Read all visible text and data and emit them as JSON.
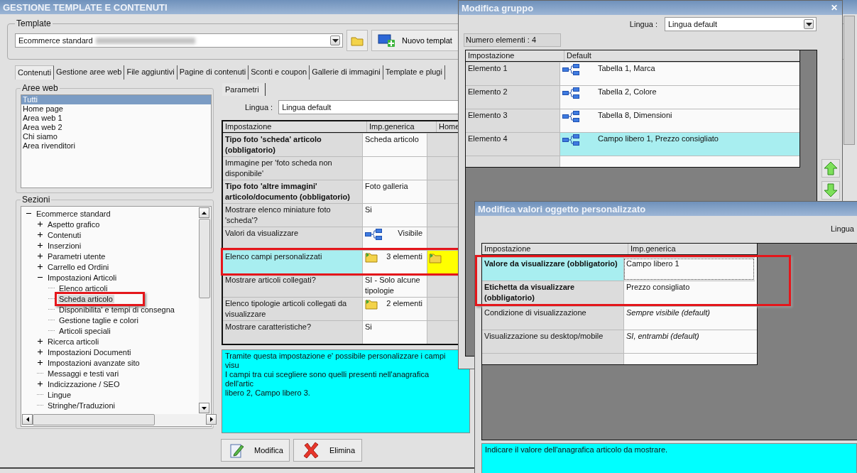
{
  "main_window": {
    "title": "GESTIONE TEMPLATE E CONTENUTI",
    "template_group": {
      "label": "Template",
      "value": "Ecommerce standard",
      "new_button": "Nuovo templat"
    },
    "tabs": [
      {
        "label": "Contenuti",
        "selected": true
      },
      {
        "label": "Gestione aree web",
        "selected": false
      },
      {
        "label": "File aggiuntivi",
        "selected": false
      },
      {
        "label": "Pagine di contenuti",
        "selected": false
      },
      {
        "label": "Sconti e coupon",
        "selected": false
      },
      {
        "label": "Gallerie di immagini",
        "selected": false
      },
      {
        "label": "Template e plugi",
        "selected": false
      }
    ],
    "aree_web": {
      "label": "Aree web",
      "items": [
        {
          "label": "Tutti",
          "selected": true
        },
        {
          "label": "Home page",
          "selected": false
        },
        {
          "label": "Area web 1",
          "selected": false
        },
        {
          "label": "Area web 2",
          "selected": false
        },
        {
          "label": "Chi siamo",
          "selected": false
        },
        {
          "label": "Area rivenditori",
          "selected": false
        }
      ]
    },
    "sezioni": {
      "label": "Sezioni",
      "tree": [
        {
          "label": "Ecommerce standard",
          "expanded": true,
          "selected": false,
          "marked": false,
          "children": [
            {
              "label": "Aspetto grafico",
              "expanded": false,
              "selected": false,
              "marked": false
            },
            {
              "label": "Contenuti",
              "expanded": false,
              "selected": false,
              "marked": false
            },
            {
              "label": "Inserzioni",
              "expanded": false,
              "selected": false,
              "marked": false
            },
            {
              "label": "Parametri utente",
              "expanded": false,
              "selected": false,
              "marked": false
            },
            {
              "label": "Carrello ed Ordini",
              "expanded": false,
              "selected": false,
              "marked": false
            },
            {
              "label": "Impostazioni Articoli",
              "expanded": true,
              "selected": false,
              "marked": false,
              "children": [
                {
                  "label": "Elenco articoli",
                  "selected": false,
                  "marked": false
                },
                {
                  "label": "Scheda articolo",
                  "selected": true,
                  "marked": true
                },
                {
                  "label": "Disponibilita' e tempi di consegna",
                  "selected": false,
                  "marked": false
                },
                {
                  "label": "Gestione taglie e colori",
                  "selected": false,
                  "marked": false
                },
                {
                  "label": "Articoli speciali",
                  "selected": false,
                  "marked": false
                }
              ]
            },
            {
              "label": "Ricerca articoli",
              "expanded": false,
              "selected": false,
              "marked": false
            },
            {
              "label": "Impostazioni Documenti",
              "expanded": false,
              "selected": false,
              "marked": false
            },
            {
              "label": "Impostazioni avanzate sito",
              "expanded": false,
              "selected": false,
              "marked": false
            },
            {
              "label": "Messaggi e testi vari",
              "selected": false,
              "marked": false
            },
            {
              "label": "Indicizzazione / SEO",
              "expanded": false,
              "selected": false,
              "marked": false
            },
            {
              "label": "Lingue",
              "selected": false,
              "marked": false
            },
            {
              "label": "Stringhe/Traduzioni",
              "selected": false,
              "marked": false
            }
          ]
        }
      ]
    },
    "parametri": {
      "tab": "Parametri",
      "lingua_label": "Lingua :",
      "lingua_value": "Lingua default",
      "columns": [
        "Impostazione",
        "Imp.generica",
        "Home"
      ],
      "rows": [
        {
          "setting": "Tipo foto 'scheda' articolo (obbligatorio)",
          "required": true,
          "kind": "plain",
          "value": "Scheda articolo",
          "selected": false,
          "marked": false,
          "home_set": false
        },
        {
          "setting": "Immagine per 'foto scheda non disponibile'",
          "required": false,
          "kind": "plain",
          "selected": false,
          "marked": false,
          "home_set": false
        },
        {
          "setting": "Tipo foto 'altre immagini' articolo/documento (obbligatorio)",
          "required": true,
          "kind": "plain",
          "value": "Foto galleria",
          "selected": false,
          "marked": false,
          "home_set": false
        },
        {
          "setting": "Mostrare elenco miniature foto 'scheda'?",
          "required": false,
          "kind": "plain",
          "value": "Si",
          "selected": false,
          "marked": false,
          "home_set": false
        },
        {
          "setting": "Valori da visualizzare",
          "required": false,
          "kind": "linked",
          "value": "Visibile",
          "selected": false,
          "marked": false,
          "home_set": false
        },
        {
          "setting": "Elenco campi personalizzati",
          "required": false,
          "kind": "collection",
          "value": "3 elementi",
          "selected": true,
          "marked": true,
          "home_set": true
        },
        {
          "setting": "Mostrare articoli collegati?",
          "required": false,
          "kind": "plain",
          "value": "SI - Solo alcune tipologie",
          "selected": false,
          "marked": false,
          "home_set": false
        },
        {
          "setting": "Elenco tipologie articoli collegati da visualizzare",
          "required": false,
          "kind": "collection",
          "value": "2 elementi",
          "selected": false,
          "marked": false,
          "home_set": false
        },
        {
          "setting": "Mostrare caratteristiche?",
          "required": false,
          "kind": "plain",
          "value": "Si",
          "selected": false,
          "marked": false,
          "home_set": false
        }
      ],
      "description": [
        "Tramite questa impostazione e' possibile personalizzare i campi visu",
        "I campi tra cui scegliere sono quelli presenti nell'anagrafica dell'artic",
        "libero 2, Campo libero 3."
      ],
      "buttons": [
        {
          "label": "Modifica",
          "kind": "edit"
        },
        {
          "label": "Elimina",
          "kind": "delete"
        }
      ]
    }
  },
  "group_dialog": {
    "title": "Modifica gruppo",
    "close": "✕",
    "lingua_label": "Lingua :",
    "lingua_value": "Lingua default",
    "count": "Numero elementi : 4",
    "columns": [
      "Impostazione",
      "Default"
    ],
    "rows": [
      {
        "setting": "Elemento 1",
        "value": "Tabella 1, Marca",
        "selected": false
      },
      {
        "setting": "Elemento 2",
        "value": "Tabella 2, Colore",
        "selected": false
      },
      {
        "setting": "Elemento 3",
        "value": "Tabella 8, Dimensioni",
        "selected": false
      },
      {
        "setting": "Elemento 4",
        "value": "Campo libero 1, Prezzo consigliato",
        "selected": true
      }
    ]
  },
  "object_dialog": {
    "title": "Modifica valori oggetto personalizzato",
    "lingua_label": "Lingua",
    "columns": [
      "Impostazione",
      "Imp.generica"
    ],
    "rows": [
      {
        "setting": "Valore da visualizzare (obbligatorio)",
        "required": true,
        "value": "Campo libero 1",
        "is_default": false,
        "selected": true,
        "marked": true
      },
      {
        "setting": "Etichetta da visualizzare (obbligatorio)",
        "required": true,
        "value": "Prezzo consigliato",
        "is_default": false,
        "selected": false,
        "marked": true
      },
      {
        "setting": "Condizione di visualizzazione",
        "required": false,
        "value": "Sempre visibile (default)",
        "is_default": true,
        "selected": false,
        "marked": false
      },
      {
        "setting": "Visualizzazione su desktop/mobile",
        "required": false,
        "value": "SI, entrambi (default)",
        "is_default": true,
        "selected": false,
        "marked": false
      }
    ],
    "description": "Indicare il valore dell'anagrafica articolo da mostrare."
  }
}
